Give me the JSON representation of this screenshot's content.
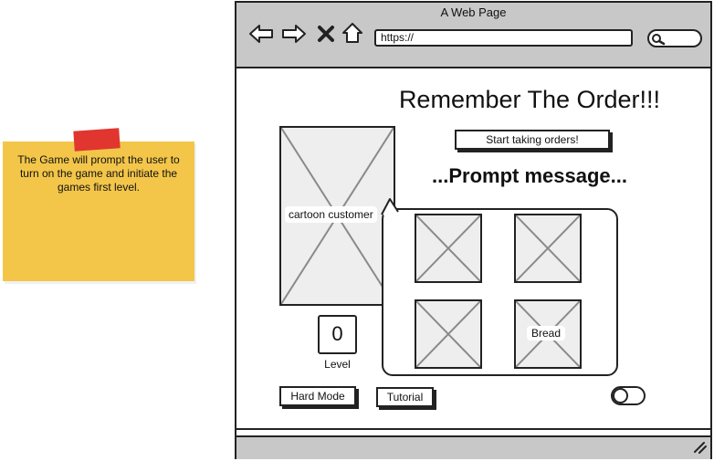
{
  "sticky_note": {
    "text": "The Game will prompt the user to turn on the game and initiate the games first level.",
    "color": "#f3c64a",
    "tape_color": "#e0362f"
  },
  "browser": {
    "window_title": "A Web Page",
    "address": "https://",
    "nav_icons": [
      "back-arrow-icon",
      "forward-arrow-icon",
      "close-x-icon",
      "home-icon"
    ],
    "search_icon": "search-icon",
    "resize_icon": "resize-grip-icon"
  },
  "page": {
    "heading": "Remember The Order!!!",
    "start_button": "Start taking orders!",
    "prompt": "...Prompt message...",
    "customer_label": "cartoon customer",
    "order_tiles": [
      "",
      "",
      "",
      "Bread"
    ],
    "level_value": "0",
    "level_label": "Level",
    "hard_mode_button": "Hard Mode",
    "tutorial_button": "Tutorial",
    "toggle_state": "off"
  }
}
